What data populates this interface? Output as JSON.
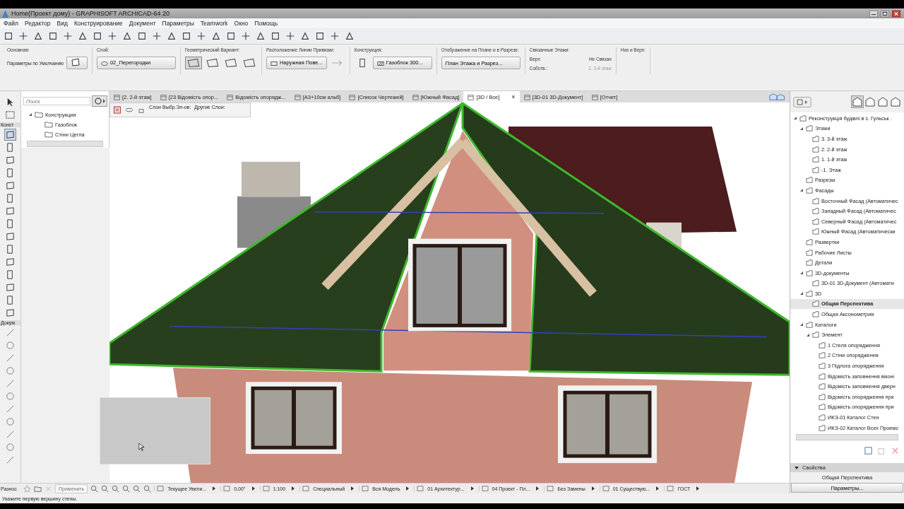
{
  "window": {
    "title": "Home(Проект дому) - GRAPHISOFT ARCHICAD-64 20"
  },
  "menu": [
    "Файл",
    "Редактор",
    "Вид",
    "Конструирование",
    "Документ",
    "Параметры",
    "Teamwork",
    "Окно",
    "Помощь"
  ],
  "info_box": {
    "main": {
      "label": "Основная:",
      "value": "Параметры по Умолчанию"
    },
    "layer": {
      "label": "Слой:",
      "value": "02_Перегородки"
    },
    "geometry": {
      "label": "Геометрический Вариант:"
    },
    "reference_line": {
      "label": "Расположение Линии Привязки:",
      "value": "Наружная Пове..."
    },
    "structure": {
      "label": "Конструкция:",
      "value": "Газоблок 300..."
    },
    "display": {
      "label": "Отображение на Плане и в Разрезе:",
      "value": "План Этажа и Разрез..."
    },
    "linked_stories": {
      "label": "Связанные Этажи:",
      "top_label": "Верх:",
      "top_value": "Не Связан",
      "home_label": "Собств.:",
      "home_value": "2. 2-й этаж"
    },
    "bottom_top": {
      "label": "Низ и Верх:"
    }
  },
  "toolbox": {
    "groups": [
      "Конст",
      "Докум"
    ]
  },
  "left_panel": {
    "search": {
      "placeholder": "Поиск"
    },
    "tree": [
      {
        "label": "Конструкции",
        "expanded": true,
        "children": [
          {
            "label": "Газоблок"
          },
          {
            "label": "Стіни Цегла"
          }
        ]
      }
    ]
  },
  "tabs": [
    {
      "label": "[2. 2-й этаж]",
      "selected": false
    },
    {
      "label": "[23 Відомість опор...",
      "selected": false
    },
    {
      "label": "Відомість опорядж...",
      "selected": false
    },
    {
      "label": "[А3+10см альб]",
      "selected": false
    },
    {
      "label": "[Список Чертежей]",
      "selected": false
    },
    {
      "label": "[Южный Фасад]",
      "selected": false
    },
    {
      "label": "[3D / Все]",
      "selected": true
    },
    {
      "label": "[3D-01 3D-Документ]",
      "selected": false
    },
    {
      "label": "[Отчет]",
      "selected": false
    }
  ],
  "tab_close": "×",
  "layers_bar": {
    "selected_label": "Слои Выбр.Эл-ов:",
    "other_label": "Другие Слои:"
  },
  "navigator": {
    "tree": [
      {
        "label": "Реконструкція будівлі в с. Гульськ .",
        "expanded": true,
        "selected": false,
        "children": [
          {
            "label": "Этажи",
            "expanded": true,
            "selected": false,
            "children": [
              {
                "label": "3. 3-й этаж",
                "selected": false
              },
              {
                "label": "2. 2-й этаж",
                "selected": false
              },
              {
                "label": "1. 1-й этаж",
                "selected": false
              },
              {
                "label": "-1. Этаж",
                "selected": false
              }
            ]
          },
          {
            "label": "Разрезы",
            "selected": false
          },
          {
            "label": "Фасады",
            "expanded": true,
            "selected": false,
            "children": [
              {
                "label": "Восточный Фасад (Автоматичес",
                "selected": false
              },
              {
                "label": "Западный Фасад (Автоматичес",
                "selected": false
              },
              {
                "label": "Северный Фасад (Автоматичес",
                "selected": false
              },
              {
                "label": "Южный Фасад (Автоматически",
                "selected": false
              }
            ]
          },
          {
            "label": "Развертки",
            "selected": false
          },
          {
            "label": "Рабочие Листы",
            "selected": false
          },
          {
            "label": "Детали",
            "selected": false
          },
          {
            "label": "3D-документы",
            "expanded": true,
            "selected": false,
            "children": [
              {
                "label": "3D-01 3D-Документ (Автомати",
                "selected": false
              }
            ]
          },
          {
            "label": "3D",
            "expanded": true,
            "selected": false,
            "children": [
              {
                "label": "Общая Перспектива",
                "selected": true
              },
              {
                "label": "Общая Аксонометрия",
                "selected": false
              }
            ]
          },
          {
            "label": "Каталоги",
            "expanded": true,
            "selected": false,
            "children": [
              {
                "label": "Элемент",
                "expanded": true,
                "selected": false,
                "children": [
                  {
                    "label": "1 Стеля опорядження",
                    "selected": false
                  },
                  {
                    "label": "2 Стіни опорядження",
                    "selected": false
                  },
                  {
                    "label": "3 Підлога опорядження",
                    "selected": false
                  },
                  {
                    "label": "Відомість заповнення віконі",
                    "selected": false
                  },
                  {
                    "label": "Відомість заповнення дверн",
                    "selected": false
                  },
                  {
                    "label": "Відомість опорядження при",
                    "selected": false
                  },
                  {
                    "label": "Відомість опорядження при",
                    "selected": false
                  },
                  {
                    "label": "ИКЭ-01 Каталог Стен",
                    "selected": false
                  },
                  {
                    "label": "ИКЭ-02 Каталог Всех Проемс",
                    "selected": false
                  }
                ]
              }
            ]
          }
        ]
      }
    ]
  },
  "properties": {
    "title": "Свойства",
    "view_name": "Общая Перспектива",
    "button": "Параметры..."
  },
  "status_bar": {
    "left_label": "Разнос",
    "apply_button": "Применить",
    "items": [
      "Текущее Увели...",
      "0,00°",
      "1:100",
      "Специальный",
      "Вся Модель",
      "01 Архитектур...",
      "04 Проект - Пл...",
      "Без Замены",
      "01 Существую...",
      "ГОСТ"
    ]
  },
  "message": "Укажите первую вершину стены."
}
